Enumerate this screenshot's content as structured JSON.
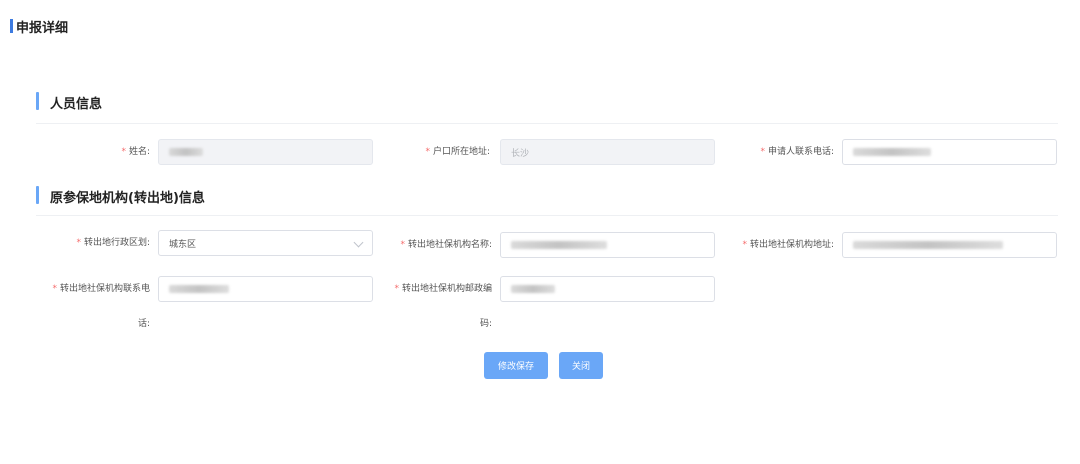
{
  "header": {
    "title": "申报详细"
  },
  "section_personal": {
    "title": "人员信息",
    "name_label": "姓名:",
    "address_label": "户口所在地址:",
    "address_value": "长沙",
    "phone_label": "申请人联系电话:"
  },
  "section_origin": {
    "title": "原参保地机构(转出地)信息",
    "region_label": "转出地行政区划:",
    "region_value": "城东区",
    "org_name_label": "转出地社保机构名称:",
    "org_address_label": "转出地社保机构地址:",
    "org_phone_label_line1": "转出地社保机构联系电",
    "org_phone_label_line2": "话:",
    "org_zip_label_line1": "转出地社保机构邮政编",
    "org_zip_label_line2": "码:"
  },
  "actions": {
    "save_label": "修改保存",
    "close_label": "关闭"
  },
  "colors": {
    "accent": "#6aa7f7",
    "required": "#f56c6c"
  }
}
